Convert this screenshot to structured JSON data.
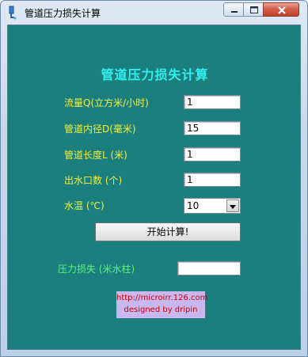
{
  "window": {
    "title": "管道压力损失计算",
    "controls": [
      "minimize-icon",
      "maximize-icon",
      "close-icon"
    ]
  },
  "form": {
    "heading": "管道压力损失计算",
    "fields": [
      {
        "label": "流量Q(立方米/小时)",
        "value": "1"
      },
      {
        "label": "管道内径D(毫米)",
        "value": "15"
      },
      {
        "label": "管道长度L (米)",
        "value": "1"
      },
      {
        "label": "出水口数 (个)",
        "value": "1"
      }
    ],
    "temperature": {
      "label": "水温 (℃)",
      "selected": "10"
    },
    "calculate_button": "开始计算!",
    "result": {
      "label": "压力损失 (米水柱)",
      "value": ""
    },
    "footer": {
      "url": "http://microirr.126.com",
      "credit": "designed  by  dripin"
    }
  },
  "colors": {
    "client_background": "#1a7f7d",
    "heading": "#30f0f0",
    "label": "#f0f040",
    "result_label": "#60f080",
    "footer_background": "#c9b8f0",
    "footer_text": "#d00000"
  }
}
